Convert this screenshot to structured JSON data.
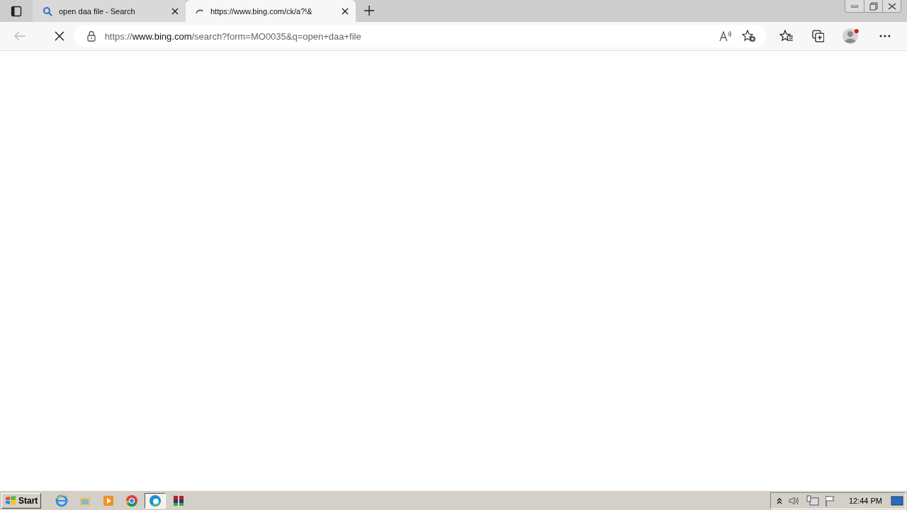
{
  "tabs": [
    {
      "kind": "search",
      "title": "open daa file - Search",
      "selected": false
    },
    {
      "kind": "loading",
      "title": "https://www.bing.com/ck/a?!&",
      "selected": true
    }
  ],
  "address_bar": {
    "scheme": "https://",
    "host": "www.bing.com",
    "path": "/search?form=MO0035&q=open+daa+file"
  },
  "taskbar": {
    "start": "Start",
    "apps": [
      {
        "kind": "ie",
        "selected": false
      },
      {
        "kind": "explorer",
        "selected": false
      },
      {
        "kind": "media",
        "selected": false
      },
      {
        "kind": "chrome",
        "selected": false
      },
      {
        "kind": "edge",
        "selected": true
      },
      {
        "kind": "winrar",
        "selected": false
      }
    ],
    "clock": "12:44 PM"
  }
}
